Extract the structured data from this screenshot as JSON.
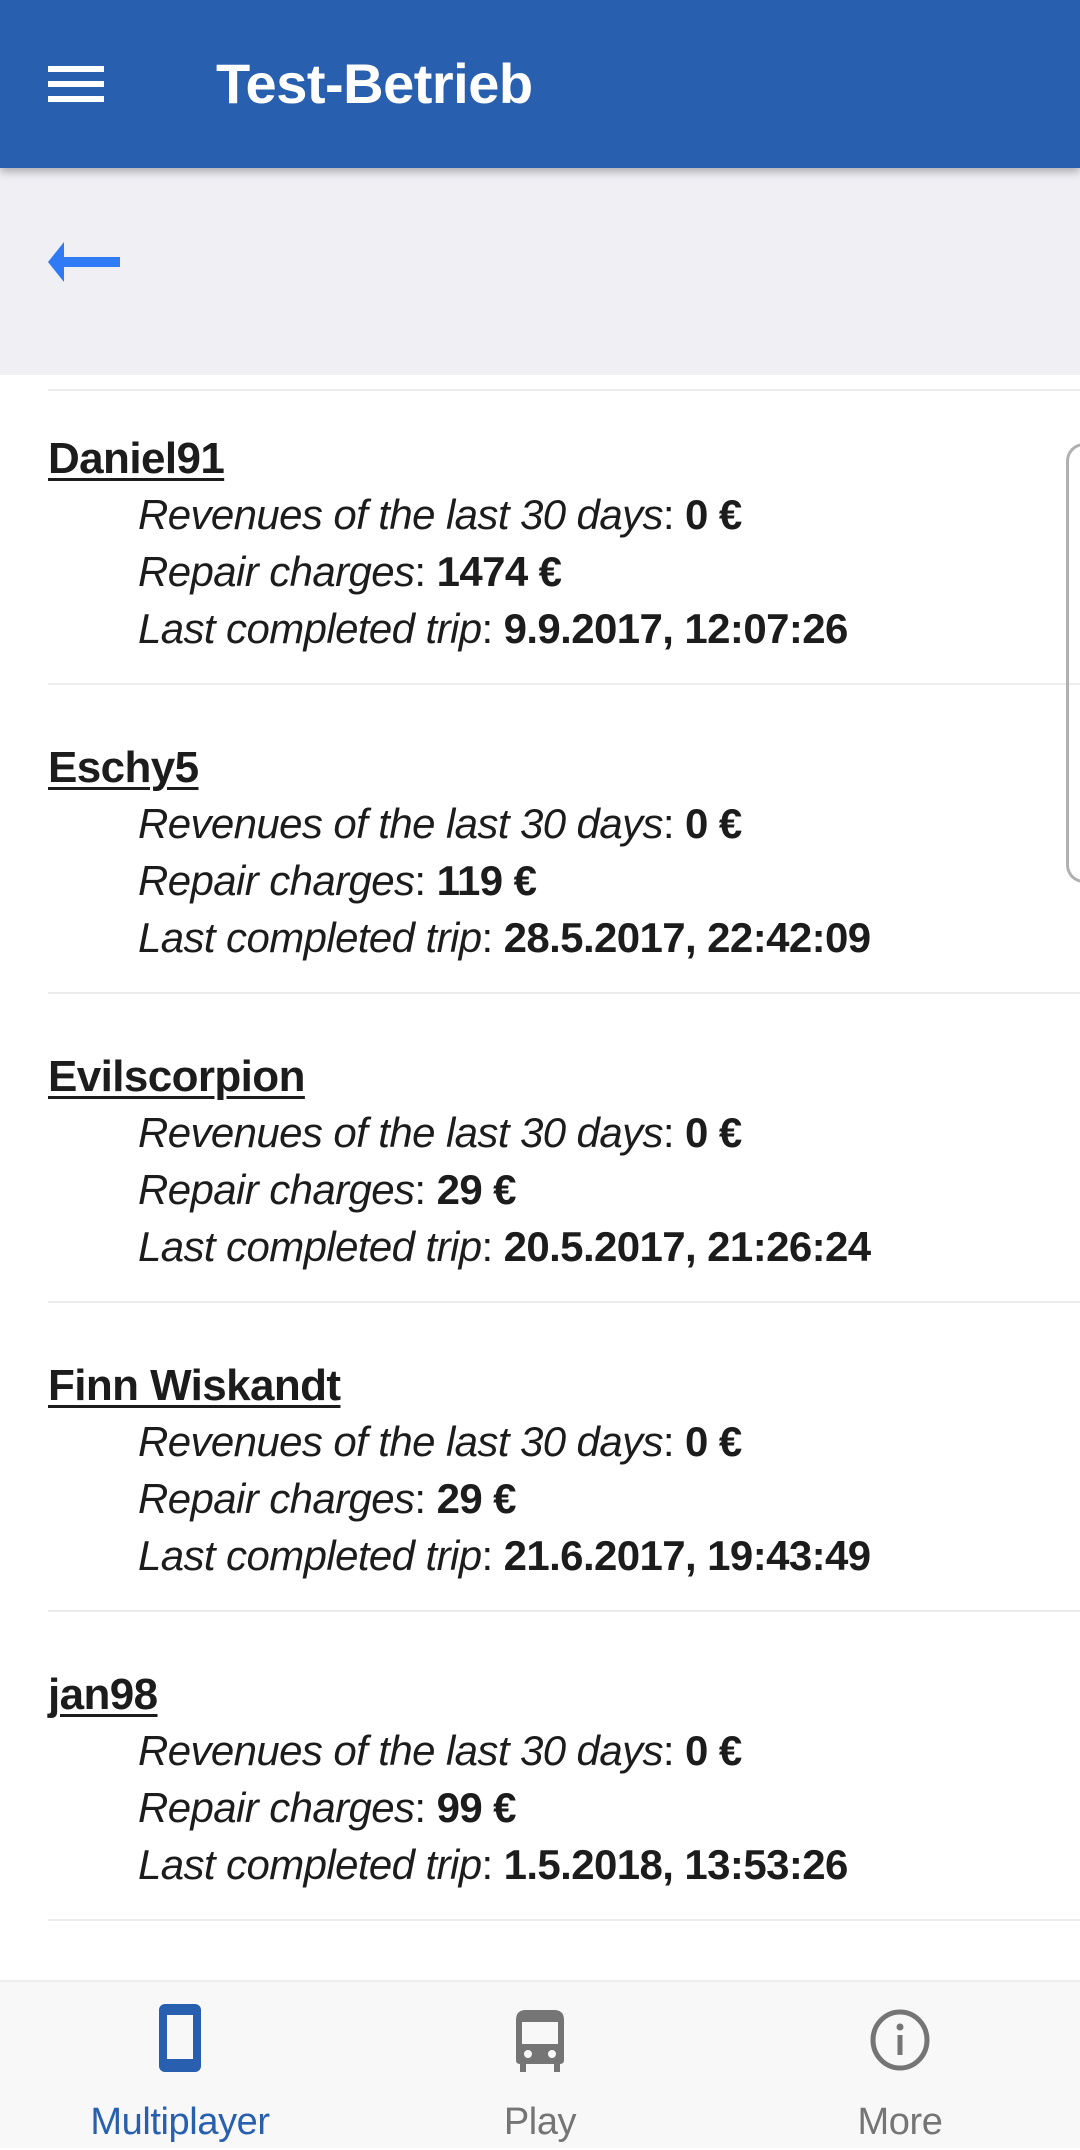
{
  "appbar": {
    "title": "Test-Betrieb",
    "menu_icon": "hamburger-menu-icon",
    "color": "#285fae"
  },
  "subheader": {
    "back_icon": "arrow-left-icon",
    "back_color": "#2f7bf5"
  },
  "entries": [
    {
      "name": "Daniel91",
      "revenue_label": "Revenues of the last 30 days",
      "revenue_value": "0 €",
      "repair_label": "Repair charges",
      "repair_value": "1474 €",
      "trip_label": "Last completed trip",
      "trip_value": "9.9.2017, 12:07:26"
    },
    {
      "name": "Eschy5",
      "revenue_label": "Revenues of the last 30 days",
      "revenue_value": "0 €",
      "repair_label": "Repair charges",
      "repair_value": "119 €",
      "trip_label": "Last completed trip",
      "trip_value": "28.5.2017, 22:42:09"
    },
    {
      "name": "Evilscorpion",
      "revenue_label": "Revenues of the last 30 days",
      "revenue_value": "0 €",
      "repair_label": "Repair charges",
      "repair_value": "29 €",
      "trip_label": "Last completed trip",
      "trip_value": "20.5.2017, 21:26:24"
    },
    {
      "name": "Finn Wiskandt",
      "revenue_label": "Revenues of the last 30 days",
      "revenue_value": "0 €",
      "repair_label": "Repair charges",
      "repair_value": "29 €",
      "trip_label": "Last completed trip",
      "trip_value": "21.6.2017, 19:43:49"
    },
    {
      "name": "jan98",
      "revenue_label": "Revenues of the last 30 days",
      "revenue_value": "0 €",
      "repair_label": "Repair charges",
      "repair_value": "99 €",
      "trip_label": "Last completed trip",
      "trip_value": "1.5.2018, 13:53:26"
    }
  ],
  "bottom_nav": {
    "items": [
      {
        "label": "Multiplayer",
        "icon": "smartphone-icon",
        "active": true
      },
      {
        "label": "Play",
        "icon": "bus-icon",
        "active": false
      },
      {
        "label": "More",
        "icon": "info-circle-icon",
        "active": false
      }
    ],
    "active_color": "#285fae",
    "inactive_color": "#757575"
  }
}
